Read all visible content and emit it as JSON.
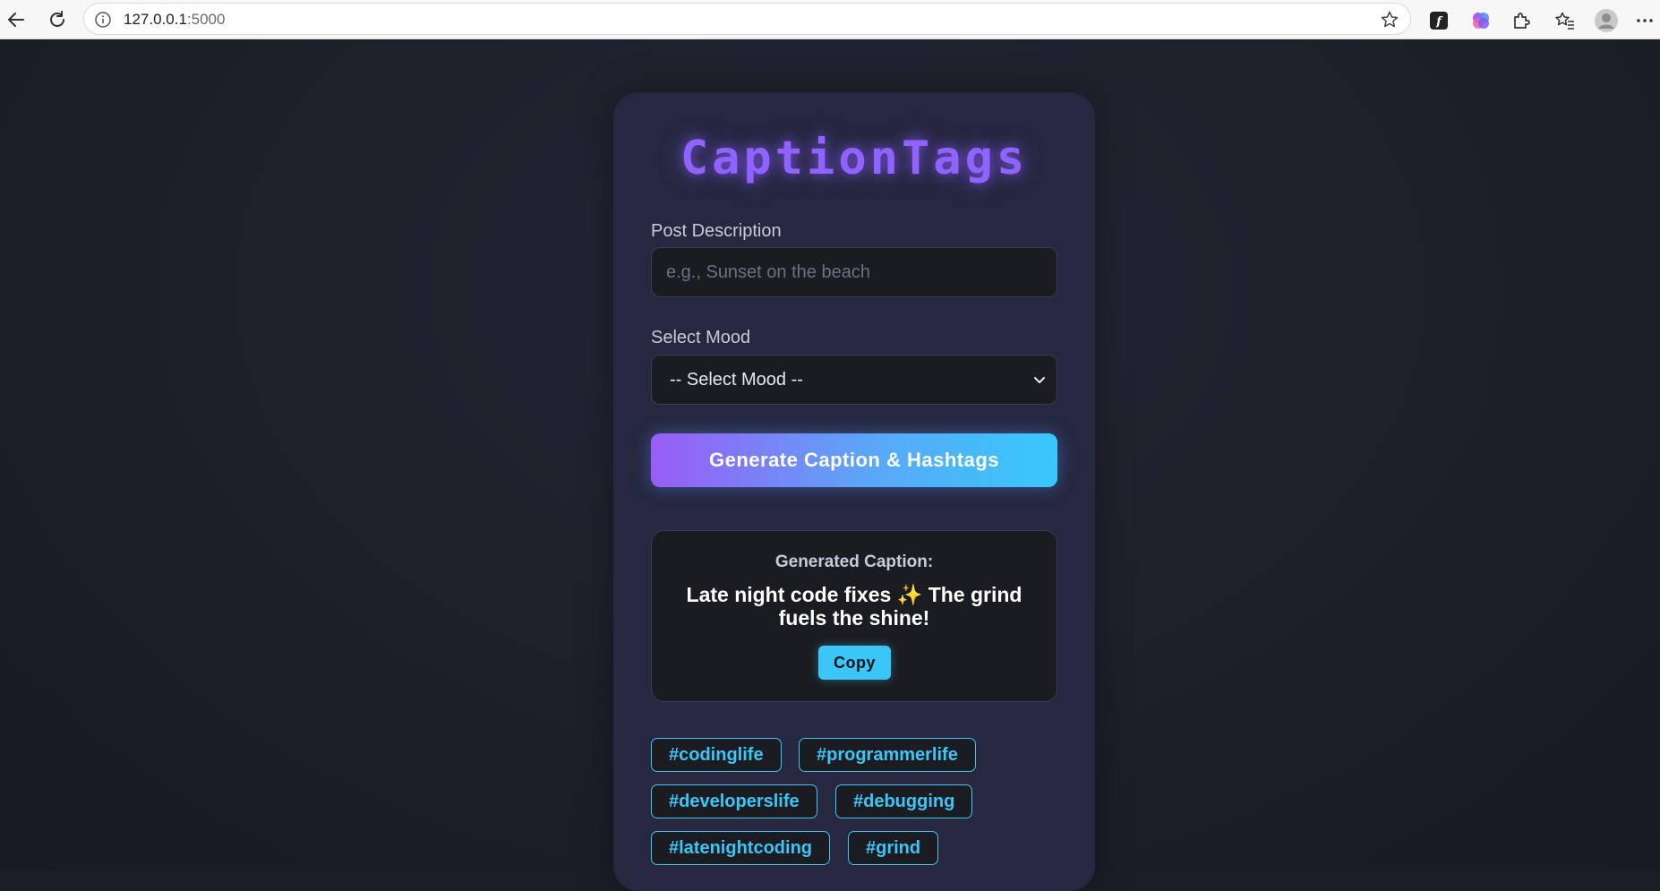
{
  "browser": {
    "url_host": "127.0.0.1",
    "url_port": ":5000"
  },
  "app": {
    "logo": "CaptionTags",
    "post_description_label": "Post Description",
    "post_description_placeholder": "e.g., Sunset on the beach",
    "post_description_value": "",
    "mood_label": "Select Mood",
    "mood_selected": "-- Select Mood --",
    "generate_button": "Generate Caption & Hashtags",
    "result_title": "Generated Caption:",
    "caption_text": "Late night code fixes ✨ The grind fuels the shine!",
    "copy_button": "Copy",
    "hashtags": [
      "#codinglife",
      "#programmerlife",
      "#developerslife",
      "#debugging",
      "#latenightcoding",
      "#grind"
    ]
  },
  "colors": {
    "accent_purple": "#8f63ff",
    "accent_cyan": "#3ac6f6",
    "card_bg": "#262840",
    "field_bg": "#1b1c22"
  },
  "icons": [
    "back-arrow-icon",
    "reload-icon",
    "info-icon",
    "star-icon",
    "fx-extension-icon",
    "copilot-icon",
    "puzzle-extensions-icon",
    "favorites-icon",
    "profile-avatar-icon",
    "more-menu-icon",
    "chevron-down-icon"
  ]
}
